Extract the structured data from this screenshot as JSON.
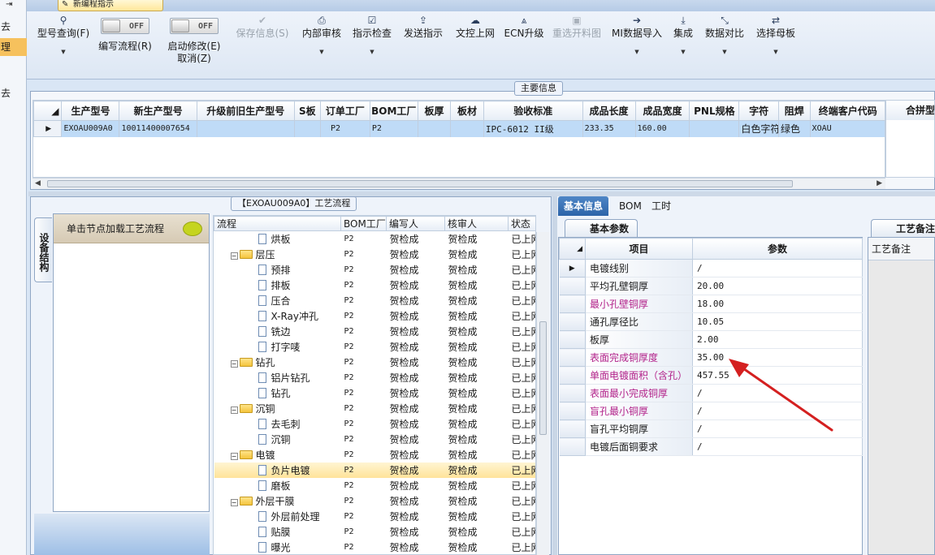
{
  "window": {
    "title": "新编程指示"
  },
  "left_strip": {
    "items": [
      "去",
      "理",
      "去"
    ]
  },
  "toolbar": {
    "buttons": [
      {
        "label": "型号查询(F)",
        "icon": "search-icon"
      },
      {
        "label": "编写流程(R)",
        "toggle": "OFF"
      },
      {
        "label": "启动修改(E)",
        "sub": "取消(Z)",
        "toggle": "OFF"
      },
      {
        "label": "保存信息(S)",
        "icon": "check-icon",
        "disabled": true
      },
      {
        "label": "内部审核",
        "icon": "print-icon"
      },
      {
        "label": "指示检查",
        "icon": "checkbox-icon"
      },
      {
        "label": "发送指示",
        "icon": "upload-icon"
      },
      {
        "label": "文控上网",
        "icon": "cloud-upload-icon"
      },
      {
        "label": "ECN升级",
        "icon": "road-icon"
      },
      {
        "label": "重选开料图",
        "icon": "image-icon",
        "disabled": true
      },
      {
        "label": "MI数据导入",
        "icon": "login-icon"
      },
      {
        "label": "集成",
        "icon": "download-icon"
      },
      {
        "label": "数据对比",
        "icon": "compress-icon"
      },
      {
        "label": "选择母板",
        "icon": "shuffle-icon"
      }
    ]
  },
  "main_info": {
    "caption": "主要信息",
    "columns": [
      "生产型号",
      "新生产型号",
      "升级前旧生产型号",
      "S板",
      "订单工厂",
      "BOM工厂",
      "板厚",
      "板材",
      "验收标准",
      "成品长度",
      "成品宽度",
      "PNL规格",
      "字符",
      "阻焊",
      "终端客户代码"
    ],
    "row": [
      "EXOAU009A0",
      "10011400007654",
      "",
      "",
      "P2",
      "P2",
      "",
      "",
      "IPC-6012 II级",
      "233.35",
      "160.00",
      "",
      "白色字符",
      "绿色",
      "XOAU"
    ],
    "side_header": "合拼型"
  },
  "equipment": {
    "tab_label": "设备结构",
    "hint": "单击节点加载工艺流程"
  },
  "process_flow": {
    "caption": "【EXOAU009A0】工艺流程",
    "columns": [
      "流程",
      "BOM工厂",
      "编写人",
      "核审人",
      "状态"
    ],
    "rows": [
      {
        "name": "烘板",
        "level": 2,
        "factory": "P2",
        "writer": "贺检成",
        "reviewer": "贺检成",
        "status": "已上网"
      },
      {
        "name": "层压",
        "level": 1,
        "factory": "P2",
        "writer": "贺检成",
        "reviewer": "贺检成",
        "status": "已上网"
      },
      {
        "name": "预排",
        "level": 2,
        "factory": "P2",
        "writer": "贺检成",
        "reviewer": "贺检成",
        "status": "已上网"
      },
      {
        "name": "排板",
        "level": 2,
        "factory": "P2",
        "writer": "贺检成",
        "reviewer": "贺检成",
        "status": "已上网"
      },
      {
        "name": "压合",
        "level": 2,
        "factory": "P2",
        "writer": "贺检成",
        "reviewer": "贺检成",
        "status": "已上网"
      },
      {
        "name": "X-Ray冲孔",
        "level": 2,
        "factory": "P2",
        "writer": "贺检成",
        "reviewer": "贺检成",
        "status": "已上网"
      },
      {
        "name": "铣边",
        "level": 2,
        "factory": "P2",
        "writer": "贺检成",
        "reviewer": "贺检成",
        "status": "已上网"
      },
      {
        "name": "打字唛",
        "level": 2,
        "factory": "P2",
        "writer": "贺检成",
        "reviewer": "贺检成",
        "status": "已上网"
      },
      {
        "name": "钻孔",
        "level": 1,
        "factory": "P2",
        "writer": "贺检成",
        "reviewer": "贺检成",
        "status": "已上网"
      },
      {
        "name": "铝片钻孔",
        "level": 2,
        "factory": "P2",
        "writer": "贺检成",
        "reviewer": "贺检成",
        "status": "已上网"
      },
      {
        "name": "钻孔",
        "level": 2,
        "factory": "P2",
        "writer": "贺检成",
        "reviewer": "贺检成",
        "status": "已上网"
      },
      {
        "name": "沉铜",
        "level": 1,
        "factory": "P2",
        "writer": "贺检成",
        "reviewer": "贺检成",
        "status": "已上网"
      },
      {
        "name": "去毛刺",
        "level": 2,
        "factory": "P2",
        "writer": "贺检成",
        "reviewer": "贺检成",
        "status": "已上网"
      },
      {
        "name": "沉铜",
        "level": 2,
        "factory": "P2",
        "writer": "贺检成",
        "reviewer": "贺检成",
        "status": "已上网"
      },
      {
        "name": "电镀",
        "level": 1,
        "factory": "P2",
        "writer": "贺检成",
        "reviewer": "贺检成",
        "status": "已上网"
      },
      {
        "name": "负片电镀",
        "level": 2,
        "factory": "P2",
        "writer": "贺检成",
        "reviewer": "贺检成",
        "status": "已上网",
        "selected": true
      },
      {
        "name": "磨板",
        "level": 2,
        "factory": "P2",
        "writer": "贺检成",
        "reviewer": "贺检成",
        "status": "已上网"
      },
      {
        "name": "外层干膜",
        "level": 1,
        "factory": "P2",
        "writer": "贺检成",
        "reviewer": "贺检成",
        "status": "已上网"
      },
      {
        "name": "外层前处理",
        "level": 2,
        "factory": "P2",
        "writer": "贺检成",
        "reviewer": "贺检成",
        "status": "已上网"
      },
      {
        "name": "贴膜",
        "level": 2,
        "factory": "P2",
        "writer": "贺检成",
        "reviewer": "贺检成",
        "status": "已上网"
      },
      {
        "name": "曝光",
        "level": 2,
        "factory": "P2",
        "writer": "贺检成",
        "reviewer": "贺检成",
        "status": "已上网"
      }
    ]
  },
  "detail_tabs": [
    "基本信息",
    "BOM",
    "工时"
  ],
  "basic_params": {
    "tab_label": "基本参数",
    "columns": [
      "项目",
      "参数"
    ],
    "rows": [
      {
        "item": "电镀线别",
        "value": "/",
        "highlight": false,
        "current": true
      },
      {
        "item": "平均孔壁铜厚",
        "value": "20.00",
        "highlight": false
      },
      {
        "item": "最小孔壁铜厚",
        "value": "18.00",
        "highlight": true
      },
      {
        "item": "通孔厚径比",
        "value": "10.05",
        "highlight": false
      },
      {
        "item": "板厚",
        "value": "2.00",
        "highlight": false
      },
      {
        "item": "表面完成铜厚度",
        "value": "35.00",
        "highlight": true
      },
      {
        "item": "单面电镀面积（含孔）",
        "value": "457.55",
        "highlight": true
      },
      {
        "item": "表面最小完成铜厚",
        "value": "/",
        "highlight": true
      },
      {
        "item": "盲孔最小铜厚",
        "value": "/",
        "highlight": true
      },
      {
        "item": "盲孔平均铜厚",
        "value": "/",
        "highlight": false
      },
      {
        "item": "电镀后面铜要求",
        "value": "/",
        "highlight": false
      }
    ]
  },
  "notes": {
    "tab_label": "工艺备注",
    "header": "工艺备注"
  },
  "colors": {
    "highlight_text": "#b2228a",
    "selection": "#bfdbf7",
    "tab_active": "#2d64a8",
    "arrow": "#d42020"
  }
}
